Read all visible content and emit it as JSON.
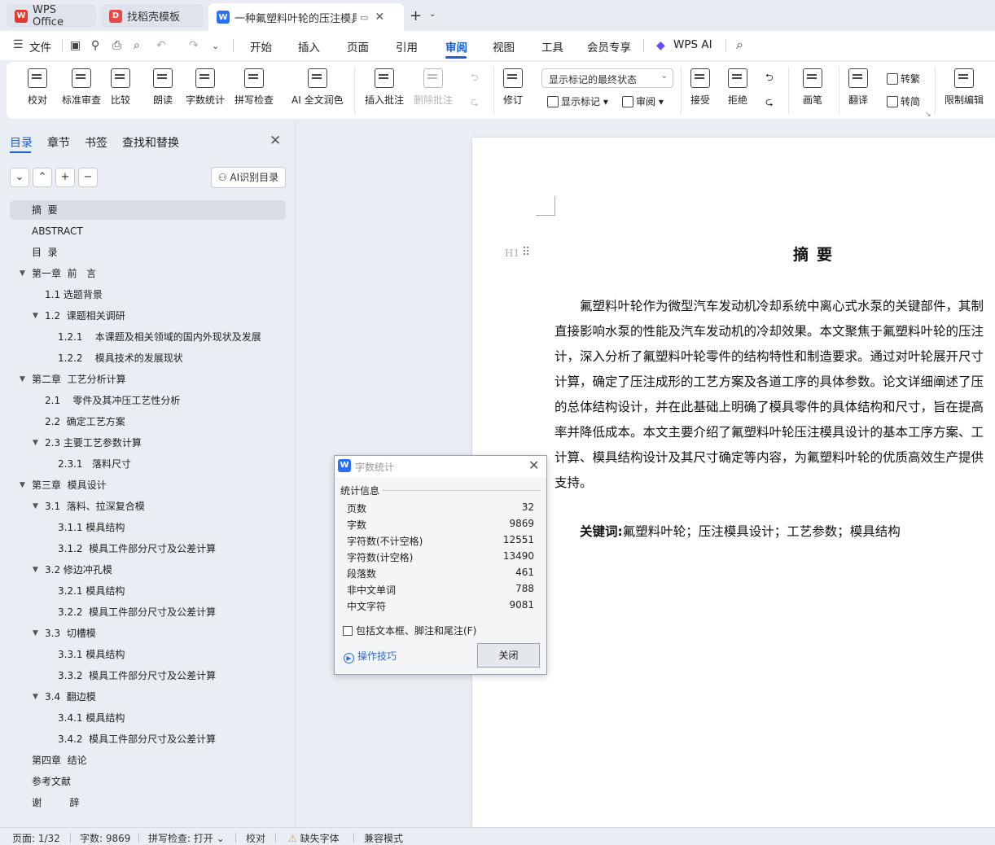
{
  "titlebar": {
    "tabs": [
      {
        "label": "WPS Office"
      },
      {
        "label": "找稻壳模板"
      },
      {
        "label": "一种氟塑料叶轮的压注模具设"
      }
    ]
  },
  "menubar": {
    "file": "文件",
    "items": [
      "开始",
      "插入",
      "页面",
      "引用",
      "审阅",
      "视图",
      "工具",
      "会员专享"
    ],
    "active": "审阅",
    "ai": "WPS AI"
  },
  "ribbon": {
    "proofread": "校对",
    "std_review": "标准审查",
    "compare": "比较",
    "read_aloud": "朗读",
    "word_count": "字数统计",
    "spell_check": "拼写检查",
    "ai_polish": "AI 全文润色",
    "insert_comment": "插入批注",
    "delete_comment": "删除批注",
    "track_changes": "修订",
    "markup_state": "显示标记的最终状态",
    "show_markup": "显示标记",
    "review_pane": "审阅",
    "accept": "接受",
    "reject": "拒绝",
    "pen": "画笔",
    "translate": "翻译",
    "to_traditional": "转繁",
    "to_simplified": "转简",
    "restrict": "限制编辑"
  },
  "sidebar": {
    "tabs": [
      "目录",
      "章节",
      "书签",
      "查找和替换"
    ],
    "ai_toc": "AI识别目录",
    "toc": [
      {
        "text": "摘  要",
        "level": 0,
        "arrow": false,
        "selected": true
      },
      {
        "text": "ABSTRACT",
        "level": 0,
        "arrow": false
      },
      {
        "text": "目  录",
        "level": 0,
        "arrow": false
      },
      {
        "text": "第一章  前   言",
        "level": 0,
        "arrow": true
      },
      {
        "text": "1.1 选题背景",
        "level": 1,
        "arrow": false
      },
      {
        "text": "1.2  课题相关调研",
        "level": 1,
        "arrow": true
      },
      {
        "text": "1.2.1    本课题及相关领域的国内外现状及发展",
        "level": 2,
        "arrow": false
      },
      {
        "text": "1.2.2    模具技术的发展现状",
        "level": 2,
        "arrow": false
      },
      {
        "text": "第二章  工艺分析计算",
        "level": 0,
        "arrow": true
      },
      {
        "text": "2.1    零件及其冲压工艺性分析",
        "level": 1,
        "arrow": false
      },
      {
        "text": "2.2  确定工艺方案",
        "level": 1,
        "arrow": false
      },
      {
        "text": "2.3 主要工艺参数计算",
        "level": 1,
        "arrow": true
      },
      {
        "text": "2.3.1   落料尺寸",
        "level": 2,
        "arrow": false
      },
      {
        "text": "第三章  模具设计",
        "level": 0,
        "arrow": true
      },
      {
        "text": "3.1  落料、拉深复合模",
        "level": 1,
        "arrow": true
      },
      {
        "text": "3.1.1 模具结构",
        "level": 2,
        "arrow": false
      },
      {
        "text": "3.1.2  模具工件部分尺寸及公差计算",
        "level": 2,
        "arrow": false
      },
      {
        "text": "3.2 修边冲孔模",
        "level": 1,
        "arrow": true
      },
      {
        "text": "3.2.1 模具结构",
        "level": 2,
        "arrow": false
      },
      {
        "text": "3.2.2  模具工件部分尺寸及公差计算",
        "level": 2,
        "arrow": false
      },
      {
        "text": "3.3  切槽模",
        "level": 1,
        "arrow": true
      },
      {
        "text": "3.3.1 模具结构",
        "level": 2,
        "arrow": false
      },
      {
        "text": "3.3.2  模具工件部分尺寸及公差计算",
        "level": 2,
        "arrow": false
      },
      {
        "text": "3.4  翻边模",
        "level": 1,
        "arrow": true
      },
      {
        "text": "3.4.1 模具结构",
        "level": 2,
        "arrow": false
      },
      {
        "text": "3.4.2  模具工件部分尺寸及公差计算",
        "level": 2,
        "arrow": false
      },
      {
        "text": "第四章  结论",
        "level": 0,
        "arrow": false
      },
      {
        "text": "参考文献",
        "level": 0,
        "arrow": false
      },
      {
        "text": "谢         辞",
        "level": 0,
        "arrow": false
      }
    ]
  },
  "document": {
    "title": "摘要",
    "h1_marker": "H1",
    "lines": [
      "氟塑料叶轮作为微型汽车发动机冷却系统中离心式水泵的关键部件，其制",
      "直接影响水泵的性能及汽车发动机的冷却效果。本文聚焦于氟塑料叶轮的压注",
      "计，深入分析了氟塑料叶轮零件的结构特性和制造要求。通过对叶轮展开尺寸",
      "计算，确定了压注成形的工艺方案及各道工序的具体参数。论文详细阐述了压",
      "的总体结构设计，并在此基础上明确了模具零件的具体结构和尺寸，旨在提高",
      "率并降低成本。本文主要介绍了氟塑料叶轮压注模具设计的基本工序方案、工",
      "计算、模具结构设计及其尺寸确定等内容，为氟塑料叶轮的优质高效生产提供",
      "支持。"
    ],
    "keywords_label": "关键词:",
    "keywords": "氟塑料叶轮；压注模具设计；工艺参数；模具结构"
  },
  "dialog": {
    "title": "字数统计",
    "group": "统计信息",
    "rows": [
      {
        "label": "页数",
        "value": "32"
      },
      {
        "label": "字数",
        "value": "9869"
      },
      {
        "label": "字符数(不计空格)",
        "value": "12551"
      },
      {
        "label": "字符数(计空格)",
        "value": "13490"
      },
      {
        "label": "段落数",
        "value": "461"
      },
      {
        "label": "非中文单词",
        "value": "788"
      },
      {
        "label": "中文字符",
        "value": "9081"
      }
    ],
    "checkbox": "包括文本框、脚注和尾注(F)",
    "tips": "操作技巧",
    "close": "关闭"
  },
  "statusbar": {
    "page": "页面: 1/32",
    "words": "字数: 9869",
    "spell": "拼写检查: 打开",
    "proof": "校对",
    "missing_font": "缺失字体",
    "compat": "兼容模式"
  }
}
